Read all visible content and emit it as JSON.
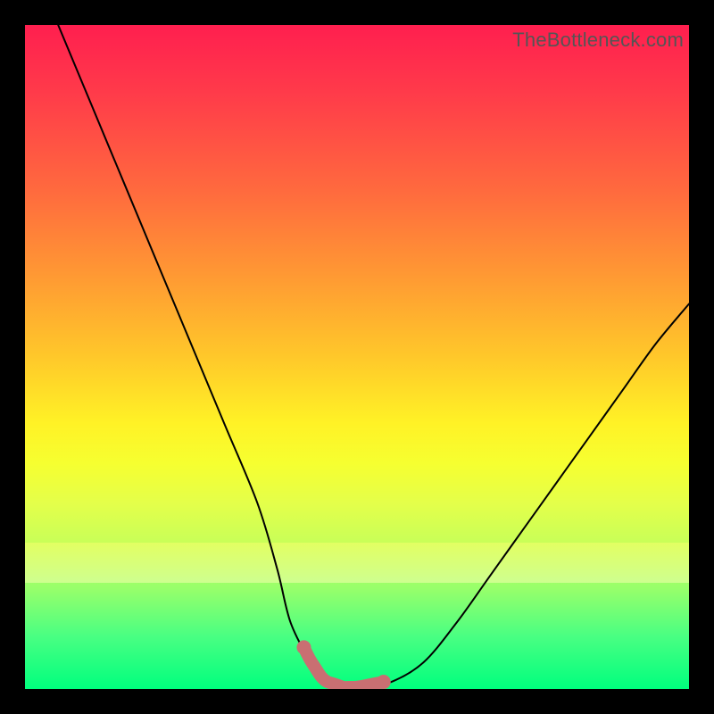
{
  "watermark": "TheBottleneck.com",
  "chart_data": {
    "type": "line",
    "title": "",
    "xlabel": "",
    "ylabel": "",
    "xlim": [
      0,
      100
    ],
    "ylim": [
      0,
      100
    ],
    "series": [
      {
        "name": "bottleneck-curve",
        "x": [
          5,
          10,
          15,
          20,
          25,
          30,
          35,
          38,
          40,
          43,
          45,
          48,
          50,
          55,
          60,
          65,
          70,
          75,
          80,
          85,
          90,
          95,
          100
        ],
        "values": [
          100,
          88,
          76,
          64,
          52,
          40,
          28,
          18,
          10,
          4,
          1,
          0,
          0,
          1,
          4,
          10,
          17,
          24,
          31,
          38,
          45,
          52,
          58
        ]
      }
    ],
    "annotations": [
      {
        "name": "optimal-range-marker",
        "x_range": [
          42,
          54
        ],
        "color": "#c96f72"
      }
    ]
  },
  "colors": {
    "curve": "#000000",
    "marker": "#c96f72",
    "background_top": "#ff1f4f",
    "background_bottom": "#00ff7e"
  }
}
